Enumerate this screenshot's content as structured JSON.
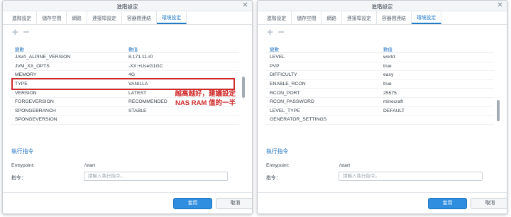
{
  "left": {
    "title": "進階設定",
    "tabs": [
      {
        "label": "進階設定",
        "active": false
      },
      {
        "label": "儲存空間",
        "active": false
      },
      {
        "label": "網路",
        "active": false
      },
      {
        "label": "連接埠設定",
        "active": false
      },
      {
        "label": "容器間連結",
        "active": false
      },
      {
        "label": "環境設定",
        "active": true
      }
    ],
    "toolbar": {
      "add": "+",
      "remove": "−"
    },
    "columns": {
      "variable": "變數",
      "value": "數值"
    },
    "rows": [
      {
        "variable": "JAVA_ALPINE_VERSION",
        "value": "8.171.11-r0"
      },
      {
        "variable": "JVM_XX_OPTS",
        "value": "-XX:+UseG1GC"
      },
      {
        "variable": "MEMORY",
        "value": "4G"
      },
      {
        "variable": "TYPE",
        "value": "VANILLA"
      },
      {
        "variable": "VERSION",
        "value": "LATEST"
      },
      {
        "variable": "FORGEVERSION",
        "value": "RECOMMENDED"
      },
      {
        "variable": "SPONGEBRANCH",
        "value": "STABLE"
      },
      {
        "variable": "SPONGEVERSION",
        "value": ""
      }
    ],
    "annotation": {
      "line1": "越高越好，建議設定",
      "line2": "NAS RAM 值的一半"
    },
    "exec_section": {
      "title": "執行指令",
      "entrypoint_label": "Entrypoint:",
      "entrypoint_value": "/start",
      "command_label": "指令：",
      "command_placeholder": "請輸入執行指令。"
    },
    "buttons": {
      "apply": "套用",
      "cancel": "取消"
    }
  },
  "right": {
    "title": "進階設定",
    "tabs": [
      {
        "label": "進階設定",
        "active": false
      },
      {
        "label": "儲存空間",
        "active": false
      },
      {
        "label": "網路",
        "active": false
      },
      {
        "label": "連接埠設定",
        "active": false
      },
      {
        "label": "容器間連結",
        "active": false
      },
      {
        "label": "環境設定",
        "active": true
      }
    ],
    "toolbar": {
      "add": "+",
      "remove": "−"
    },
    "columns": {
      "variable": "變數",
      "value": "數值"
    },
    "rows": [
      {
        "variable": "LEVEL",
        "value": "world"
      },
      {
        "variable": "PVP",
        "value": "true"
      },
      {
        "variable": "DIFFICULTY",
        "value": "easy"
      },
      {
        "variable": "ENABLE_RCON",
        "value": "true"
      },
      {
        "variable": "RCON_PORT",
        "value": "25575"
      },
      {
        "variable": "RCON_PASSWORD",
        "value": "minecraft"
      },
      {
        "variable": "LEVEL_TYPE",
        "value": "DEFAULT"
      },
      {
        "variable": "GENERATOR_SETTINGS",
        "value": ""
      }
    ],
    "exec_section": {
      "title": "執行指令",
      "entrypoint_label": "Entrypoint:",
      "entrypoint_value": "/start",
      "command_label": "指令：",
      "command_placeholder": "請輸入執行指令。"
    },
    "buttons": {
      "apply": "套用",
      "cancel": "取消"
    }
  },
  "colors": {
    "accent": "#2f8ee0",
    "link": "#2575c2",
    "annotation": "#d12a2a"
  }
}
